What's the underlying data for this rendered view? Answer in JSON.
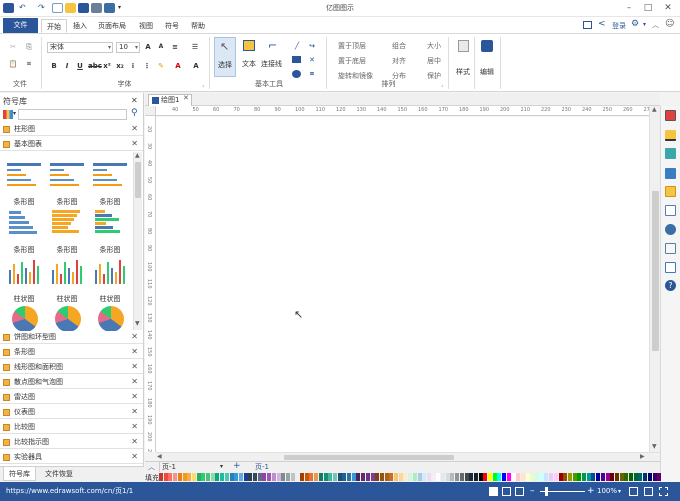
{
  "app": {
    "title": "亿图图示"
  },
  "tabs": [
    "文件",
    "开始",
    "插入",
    "页面布局",
    "视图",
    "符号",
    "帮助"
  ],
  "login_label": "登录",
  "ribbon": {
    "font_name": "宋体",
    "font_size": "10",
    "groups": {
      "file": "文件",
      "font": "字体",
      "basic_tools": "基本工具",
      "arrange": "排列"
    },
    "select_label": "选择",
    "text_label": "文本",
    "connector_label": "连接线",
    "arrange_items": [
      "置于顶层",
      "组合",
      "大小",
      "置于底层",
      "对齐",
      "居中",
      "旋转和镜像",
      "分布",
      "保护"
    ],
    "style_label": "样式",
    "edit_label": "编辑"
  },
  "sidebar": {
    "title": "符号库",
    "expanded_categories": [
      "柱形图",
      "基本图表"
    ],
    "gallery": [
      {
        "label": "条形图",
        "kind": "bar-table"
      },
      {
        "label": "条形图",
        "kind": "bar-table"
      },
      {
        "label": "条形图",
        "kind": "bar-table"
      },
      {
        "label": "条形图",
        "kind": "bar-hblue"
      },
      {
        "label": "条形图",
        "kind": "bar-horange"
      },
      {
        "label": "条形图",
        "kind": "bar-hmix"
      },
      {
        "label": "柱状图",
        "kind": "col-mix"
      },
      {
        "label": "柱状图",
        "kind": "col-mix"
      },
      {
        "label": "柱状图",
        "kind": "col-mix"
      },
      {
        "label": "",
        "kind": "pie"
      },
      {
        "label": "",
        "kind": "pie"
      },
      {
        "label": "",
        "kind": "pie"
      }
    ],
    "categories": [
      "饼图和环型图",
      "条形图",
      "线形图和面积图",
      "散点图和气泡图",
      "雷达图",
      "仪表图",
      "比较图",
      "比较指示图",
      "实验器具"
    ],
    "bottom_tabs": [
      "符号库",
      "文件恢复"
    ]
  },
  "document": {
    "tab_label": "绘图1",
    "ruler_h": [
      "40",
      "50",
      "60",
      "70",
      "80",
      "90",
      "100",
      "110",
      "120",
      "130",
      "140",
      "150",
      "160",
      "170",
      "180",
      "190",
      "200",
      "210",
      "220",
      "230",
      "240",
      "250",
      "260",
      "270"
    ],
    "ruler_v": [
      "20",
      "30",
      "40",
      "50",
      "60",
      "70",
      "80",
      "90",
      "100",
      "110",
      "120",
      "130",
      "140",
      "150",
      "160",
      "170",
      "180",
      "190",
      "200",
      "210"
    ],
    "page_select": "页-1",
    "page_tab": "页-1",
    "fill_label": "填充"
  },
  "status": {
    "url": "https://www.edrawsoft.com/cn/",
    "page_info": "页1/1",
    "zoom": "100%"
  },
  "colors": {
    "accent": "#2b579a",
    "palette": [
      "#c0392b",
      "#e74c3c",
      "#ff6f61",
      "#f1948a",
      "#e67e22",
      "#f39c12",
      "#f5b041",
      "#f7dc6f",
      "#27ae60",
      "#2ecc71",
      "#52be80",
      "#82e0aa",
      "#16a085",
      "#1abc9c",
      "#48c9b0",
      "#2980b9",
      "#3498db",
      "#5dade2",
      "#1f3a93",
      "#2c3e50",
      "#34495e",
      "#5d6d7e",
      "#8e44ad",
      "#9b59b6",
      "#bb8fce",
      "#d2b4de",
      "#7f8c8d",
      "#95a5a6",
      "#bdc3c7",
      "#ecf0f1",
      "#a04000",
      "#d35400",
      "#dc7633",
      "#eb984e",
      "#117a65",
      "#148f77",
      "#45b39d",
      "#73c6b6",
      "#1b4f72",
      "#21618c",
      "#2874a6",
      "#3498db",
      "#4a235a",
      "#5b2c6f",
      "#6c3483",
      "#7d3c98",
      "#784212",
      "#935116",
      "#af601a",
      "#ca6f1e",
      "#f8c471",
      "#fad7a0",
      "#fdebd0",
      "#d5f5e3",
      "#abebc6",
      "#a9cce3",
      "#d6eaf8",
      "#ebdef0",
      "#f5eef8",
      "#fdfefe",
      "#e5e7e9",
      "#d7dbdd",
      "#b2babb",
      "#909497",
      "#616a6b",
      "#424949",
      "#1c2833",
      "#17202a",
      "#000000",
      "#ff0000",
      "#ffff00",
      "#00ff00",
      "#00ffff",
      "#0000ff",
      "#ff00ff",
      "#ffffff",
      "#ffcccc",
      "#ffe5cc",
      "#ffffcc",
      "#e5ffcc",
      "#ccffe5",
      "#ccffff",
      "#cce5ff",
      "#e5ccff",
      "#ffccff",
      "#990000",
      "#994c00",
      "#999900",
      "#4c9900",
      "#009900",
      "#00994c",
      "#009999",
      "#004c99",
      "#000099",
      "#4c0099",
      "#990099",
      "#660000",
      "#663300",
      "#666600",
      "#336600",
      "#006600",
      "#006633",
      "#006666",
      "#003366",
      "#000066",
      "#330066",
      "#660066"
    ]
  }
}
